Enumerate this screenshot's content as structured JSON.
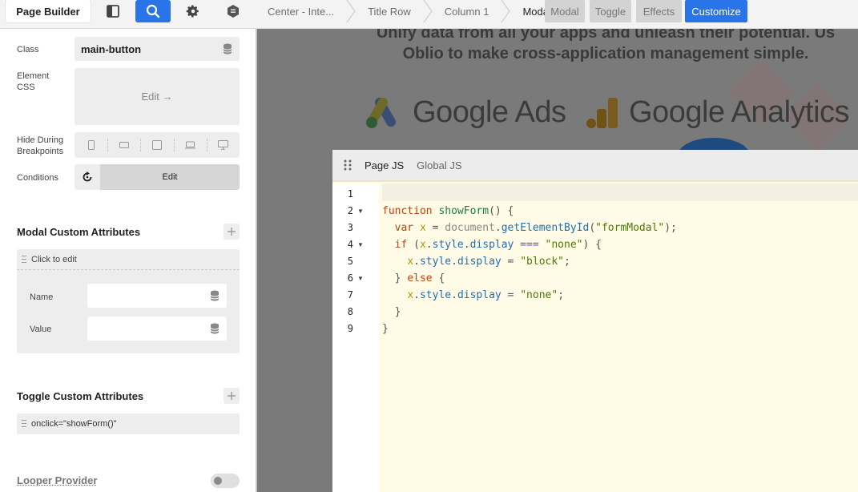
{
  "topbar": {
    "title": "Page Builder",
    "breadcrumbs": [
      "Center - Inte...",
      "Title Row",
      "Column 1",
      "Modal"
    ],
    "tabs": [
      "Modal",
      "Toggle",
      "Effects"
    ],
    "customize_label": "Customize",
    "accent": "#2a74ea"
  },
  "sidebar": {
    "class_label": "Class",
    "class_value": "main-button",
    "css_label_1": "Element",
    "css_label_2": "CSS",
    "css_edit": "Edit →",
    "hide_label_1": "Hide During",
    "hide_label_2": "Breakpoints",
    "breakpoint_icons": [
      "phone-icon",
      "phone-landscape-icon",
      "tablet-icon",
      "laptop-icon",
      "desktop-icon"
    ],
    "conditions_label": "Conditions",
    "conditions_edit": "Edit",
    "modal_attrs_title": "Modal Custom Attributes",
    "click_to_edit": "Click to edit",
    "name_label": "Name",
    "value_label": "Value",
    "toggle_attrs_title": "Toggle Custom Attributes",
    "toggle_attr_value": "onclick=\"showForm()\"",
    "looper_title": "Looper Provider"
  },
  "canvas": {
    "hero_line1": "Unify data from all your apps and unleash their potential. Us",
    "hero_line2": "Oblio to make cross-application management simple.",
    "logo1": "Google Ads",
    "logo2": "Google Analytics"
  },
  "js_panel": {
    "tab_page": "Page JS",
    "tab_global": "Global JS",
    "line_numbers": [
      "1",
      "2",
      "3",
      "4",
      "5",
      "6",
      "7",
      "8",
      "9"
    ]
  }
}
